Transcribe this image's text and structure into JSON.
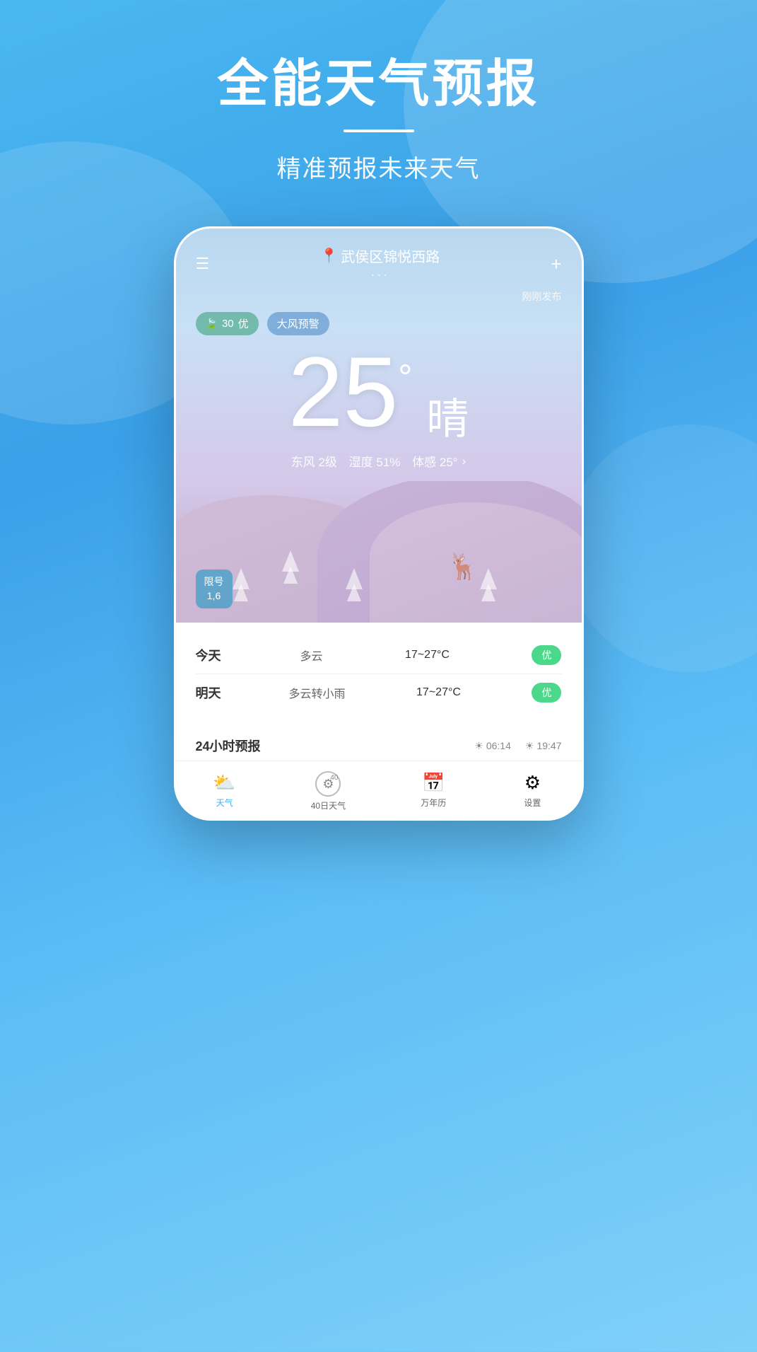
{
  "hero": {
    "title": "全能天气预报",
    "divider": "",
    "subtitle": "精准预报未来天气"
  },
  "phone": {
    "topbar": {
      "menu_icon": "☰",
      "location_pin": "📍",
      "location_name": "武侯区锦悦西路",
      "location_dots": "···",
      "add_icon": "+"
    },
    "publish_time": "刚刚发布",
    "aqi": {
      "leaf": "🍃",
      "value": "30",
      "quality": "优"
    },
    "warning": "大风预警",
    "temperature": "25",
    "degree_symbol": "°",
    "weather_desc": "晴",
    "details": {
      "wind": "东风 2级",
      "humidity": "湿度 51%",
      "feels_like": "体感 25°",
      "arrow": "›"
    },
    "license": {
      "label": "限号",
      "numbers": "1,6"
    },
    "forecast": [
      {
        "day": "今天",
        "condition": "多云",
        "temp": "17~27°C",
        "quality": "优"
      },
      {
        "day": "明天",
        "condition": "多云转小雨",
        "temp": "17~27°C",
        "quality": "优"
      }
    ],
    "hourly": {
      "title": "24小时预报",
      "sunrise": "06:14",
      "sunset": "19:47"
    }
  },
  "bottom_nav": [
    {
      "id": "weather",
      "label": "天气",
      "active": true
    },
    {
      "id": "forecast40",
      "label": "40日天气",
      "active": false
    },
    {
      "id": "calendar",
      "label": "万年历",
      "active": false
    },
    {
      "id": "settings",
      "label": "设置",
      "active": false
    }
  ]
}
